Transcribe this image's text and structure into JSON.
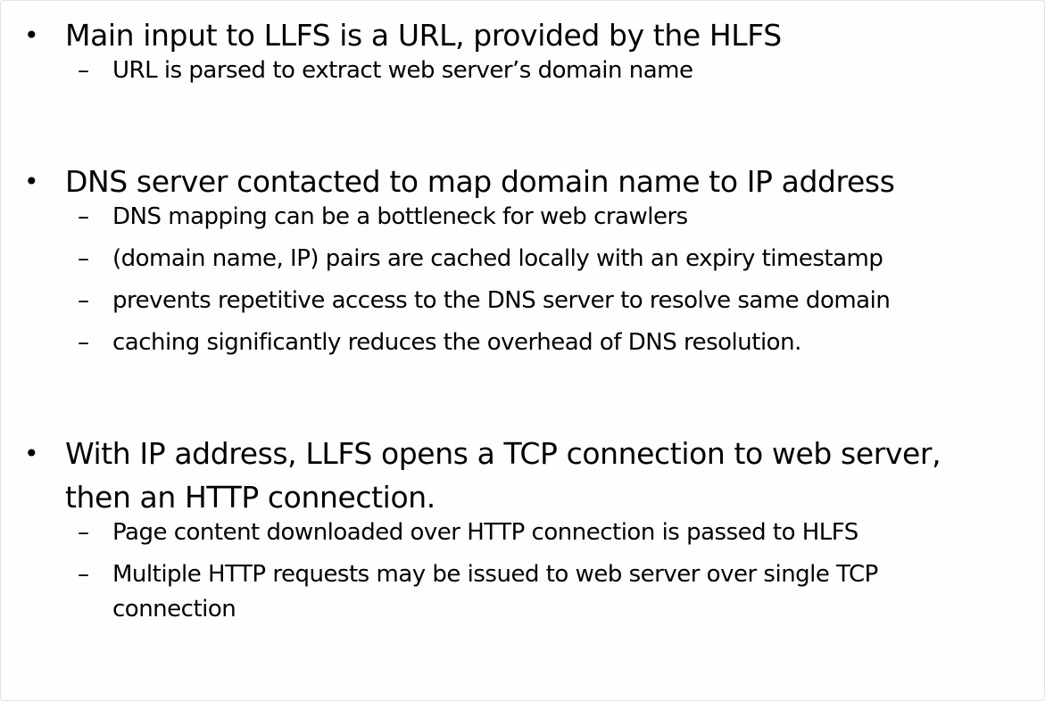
{
  "slide": {
    "bullets": [
      {
        "text": "Main input to LLFS is a URL, provided by the HLFS",
        "subs": [
          "URL is parsed to extract web server’s domain name"
        ]
      },
      {
        "text": "DNS server contacted to map domain name to IP address",
        "subs": [
          "DNS mapping can be a bottleneck for web crawlers",
          "(domain name, IP) pairs are cached locally with an expiry timestamp",
          "prevents repetitive access to the DNS server to resolve same domain",
          "caching significantly reduces the overhead of DNS resolution."
        ]
      },
      {
        "text": "With IP address, LLFS opens a TCP connection to web server, then an HTTP connection.",
        "subs": [
          "Page content downloaded over HTTP connection is passed to HLFS",
          "Multiple HTTP requests may be issued to web server over single TCP connection"
        ]
      }
    ],
    "bullet_glyph": "•",
    "dash_glyph": "–"
  }
}
